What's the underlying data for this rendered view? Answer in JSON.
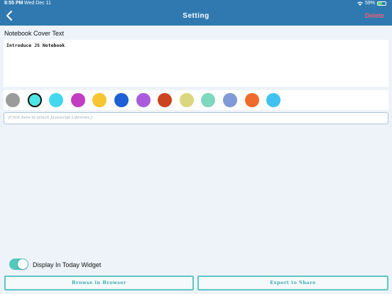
{
  "status_bar": {
    "time": "8:55 PM",
    "date": "Wed Dec 11",
    "battery": "59%",
    "battery_level": 0.59
  },
  "nav": {
    "title": "Setting",
    "delete_label": "Delete",
    "back_icon": "chevron-left-icon"
  },
  "cover": {
    "label": "Notebook Cover Text",
    "text": "Introduce JS Notebook"
  },
  "colors": {
    "swatches": [
      "#9b9b9b",
      "#4ee6e6",
      "#43d8ee",
      "#c13ec2",
      "#f7c531",
      "#1f5fd6",
      "#a95bdb",
      "#c9441f",
      "#dbd77e",
      "#7fd7bd",
      "#7f99d6",
      "#f06a2d",
      "#3fc2f0"
    ],
    "selected_index": 1
  },
  "libraries": {
    "placeholder": "[Click here to attach Javascript Libraries.]"
  },
  "widget": {
    "label": "Display In Today Widget",
    "enabled": true
  },
  "actions": {
    "browse_label": "Browse in Browser",
    "export_label": "Export to Share"
  }
}
